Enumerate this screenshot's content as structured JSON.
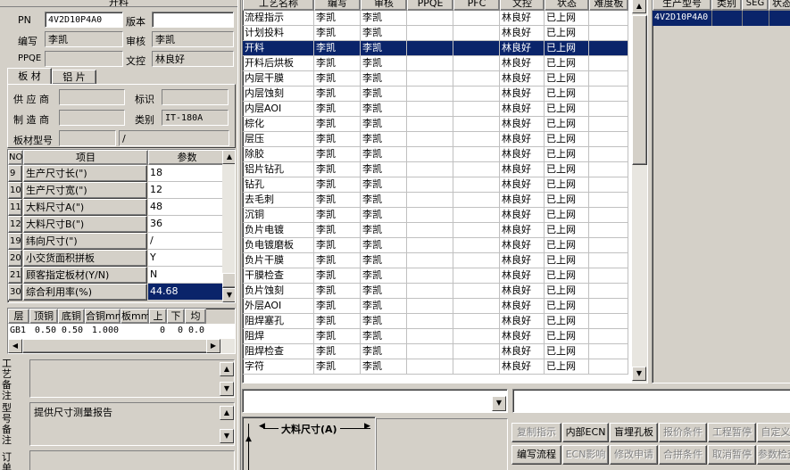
{
  "header": {
    "title": "开料"
  },
  "info": {
    "pn_label": "PN",
    "pn_value": "4V2D10P4A0",
    "version_label": "版本",
    "version_value": "",
    "author_label": "编写",
    "author_value": "李凯",
    "reviewer_label": "审核",
    "reviewer_value": "李凯",
    "ppqe_label": "PPQE",
    "ppqe_value": "",
    "control_label": "文控",
    "control_value": "林良好"
  },
  "material_tabs": [
    "板 材",
    "铝 片"
  ],
  "material": {
    "supplier_label": "供 应 商",
    "supplier_value": "",
    "mark_label": "标识",
    "mark_value": "",
    "maker_label": "制 造 商",
    "maker_value": "",
    "category_label": "类别",
    "category_value": "IT-180A",
    "model_label": "板材型号",
    "model_value": "",
    "model_value2": "/"
  },
  "params": {
    "headers": [
      "NO",
      "项目",
      "参数"
    ],
    "rows": [
      {
        "no": "9",
        "item": "生产尺寸长(\")",
        "value": "18"
      },
      {
        "no": "10",
        "item": "生产尺寸宽(\")",
        "value": "12"
      },
      {
        "no": "11",
        "item": "大料尺寸A(\")",
        "value": "48"
      },
      {
        "no": "12",
        "item": "大料尺寸B(\")",
        "value": "36"
      },
      {
        "no": "19",
        "item": "纬向尺寸(\")",
        "value": "/"
      },
      {
        "no": "20",
        "item": "小交货面积拼板",
        "value": "Y"
      },
      {
        "no": "21",
        "item": "顾客指定板材(Y/N)",
        "value": "N"
      },
      {
        "no": "30",
        "item": "综合利用率(%)",
        "value": "44.68"
      }
    ]
  },
  "layers": {
    "headers": [
      "层",
      "顶铜",
      "底铜",
      "合铜mm",
      "板mm",
      "上",
      "下",
      "均"
    ],
    "row": [
      "GB1",
      "0.50",
      "0.50",
      "1.000",
      "",
      "0",
      "0",
      "0.0"
    ]
  },
  "remarks": {
    "process_label": "工艺备注",
    "process_value": "",
    "model_label": "型号备注",
    "model_value": "提供尺寸测量报告",
    "order_label": "订单"
  },
  "process_grid": {
    "headers": [
      "工艺名称",
      "编写",
      "审核",
      "PPQE",
      "PFC",
      "文控",
      "状态",
      "难度板"
    ],
    "rows": [
      {
        "name": "流程指示",
        "author": "李凯",
        "review": "李凯",
        "ppqe": "",
        "pfc": "",
        "ctrl": "林良好",
        "status": "已上网",
        "diff": ""
      },
      {
        "name": "计划投料",
        "author": "李凯",
        "review": "李凯",
        "ppqe": "",
        "pfc": "",
        "ctrl": "林良好",
        "status": "已上网",
        "diff": ""
      },
      {
        "name": "开料",
        "author": "李凯",
        "review": "李凯",
        "ppqe": "",
        "pfc": "",
        "ctrl": "林良好",
        "status": "已上网",
        "diff": ""
      },
      {
        "name": "开料后烘板",
        "author": "李凯",
        "review": "李凯",
        "ppqe": "",
        "pfc": "",
        "ctrl": "林良好",
        "status": "已上网",
        "diff": ""
      },
      {
        "name": "内层干膜",
        "author": "李凯",
        "review": "李凯",
        "ppqe": "",
        "pfc": "",
        "ctrl": "林良好",
        "status": "已上网",
        "diff": ""
      },
      {
        "name": "内层蚀刻",
        "author": "李凯",
        "review": "李凯",
        "ppqe": "",
        "pfc": "",
        "ctrl": "林良好",
        "status": "已上网",
        "diff": ""
      },
      {
        "name": "内层AOI",
        "author": "李凯",
        "review": "李凯",
        "ppqe": "",
        "pfc": "",
        "ctrl": "林良好",
        "status": "已上网",
        "diff": ""
      },
      {
        "name": "棕化",
        "author": "李凯",
        "review": "李凯",
        "ppqe": "",
        "pfc": "",
        "ctrl": "林良好",
        "status": "已上网",
        "diff": ""
      },
      {
        "name": "层压",
        "author": "李凯",
        "review": "李凯",
        "ppqe": "",
        "pfc": "",
        "ctrl": "林良好",
        "status": "已上网",
        "diff": ""
      },
      {
        "name": "除胶",
        "author": "李凯",
        "review": "李凯",
        "ppqe": "",
        "pfc": "",
        "ctrl": "林良好",
        "status": "已上网",
        "diff": ""
      },
      {
        "name": "铝片钻孔",
        "author": "李凯",
        "review": "李凯",
        "ppqe": "",
        "pfc": "",
        "ctrl": "林良好",
        "status": "已上网",
        "diff": ""
      },
      {
        "name": "钻孔",
        "author": "李凯",
        "review": "李凯",
        "ppqe": "",
        "pfc": "",
        "ctrl": "林良好",
        "status": "已上网",
        "diff": ""
      },
      {
        "name": "去毛刺",
        "author": "李凯",
        "review": "李凯",
        "ppqe": "",
        "pfc": "",
        "ctrl": "林良好",
        "status": "已上网",
        "diff": ""
      },
      {
        "name": "沉铜",
        "author": "李凯",
        "review": "李凯",
        "ppqe": "",
        "pfc": "",
        "ctrl": "林良好",
        "status": "已上网",
        "diff": ""
      },
      {
        "name": "负片电镀",
        "author": "李凯",
        "review": "李凯",
        "ppqe": "",
        "pfc": "",
        "ctrl": "林良好",
        "status": "已上网",
        "diff": ""
      },
      {
        "name": "负电镀磨板",
        "author": "李凯",
        "review": "李凯",
        "ppqe": "",
        "pfc": "",
        "ctrl": "林良好",
        "status": "已上网",
        "diff": ""
      },
      {
        "name": "负片干膜",
        "author": "李凯",
        "review": "李凯",
        "ppqe": "",
        "pfc": "",
        "ctrl": "林良好",
        "status": "已上网",
        "diff": ""
      },
      {
        "name": "干膜检查",
        "author": "李凯",
        "review": "李凯",
        "ppqe": "",
        "pfc": "",
        "ctrl": "林良好",
        "status": "已上网",
        "diff": ""
      },
      {
        "name": "负片蚀刻",
        "author": "李凯",
        "review": "李凯",
        "ppqe": "",
        "pfc": "",
        "ctrl": "林良好",
        "status": "已上网",
        "diff": ""
      },
      {
        "name": "外层AOI",
        "author": "李凯",
        "review": "李凯",
        "ppqe": "",
        "pfc": "",
        "ctrl": "林良好",
        "status": "已上网",
        "diff": ""
      },
      {
        "name": "阻焊塞孔",
        "author": "李凯",
        "review": "李凯",
        "ppqe": "",
        "pfc": "",
        "ctrl": "林良好",
        "status": "已上网",
        "diff": ""
      },
      {
        "name": "阻焊",
        "author": "李凯",
        "review": "李凯",
        "ppqe": "",
        "pfc": "",
        "ctrl": "林良好",
        "status": "已上网",
        "diff": ""
      },
      {
        "name": "阻焊检查",
        "author": "李凯",
        "review": "李凯",
        "ppqe": "",
        "pfc": "",
        "ctrl": "林良好",
        "status": "已上网",
        "diff": ""
      },
      {
        "name": "字符",
        "author": "李凯",
        "review": "李凯",
        "ppqe": "",
        "pfc": "",
        "ctrl": "林良好",
        "status": "已上网",
        "diff": ""
      }
    ],
    "selected_index": 2
  },
  "right_grid": {
    "headers": [
      "生产型号",
      "类别",
      "SEG",
      "状态"
    ],
    "row": "4V2D10P4A0"
  },
  "drawing": {
    "dimension_label": "大料尺寸(A)"
  },
  "buttons": {
    "row1": [
      {
        "label": "复制指示",
        "enabled": false
      },
      {
        "label": "内部ECN",
        "enabled": true
      },
      {
        "label": "盲埋孔板",
        "enabled": true
      },
      {
        "label": "报价条件",
        "enabled": false
      },
      {
        "label": "工程暂停",
        "enabled": false
      },
      {
        "label": "自定义",
        "enabled": false
      }
    ],
    "row2": [
      {
        "label": "编写流程",
        "enabled": true
      },
      {
        "label": "ECN影响",
        "enabled": false
      },
      {
        "label": "修改申请",
        "enabled": false
      },
      {
        "label": "合拼条件",
        "enabled": false
      },
      {
        "label": "取消暂停",
        "enabled": false
      },
      {
        "label": "参数检查",
        "enabled": false
      }
    ]
  }
}
